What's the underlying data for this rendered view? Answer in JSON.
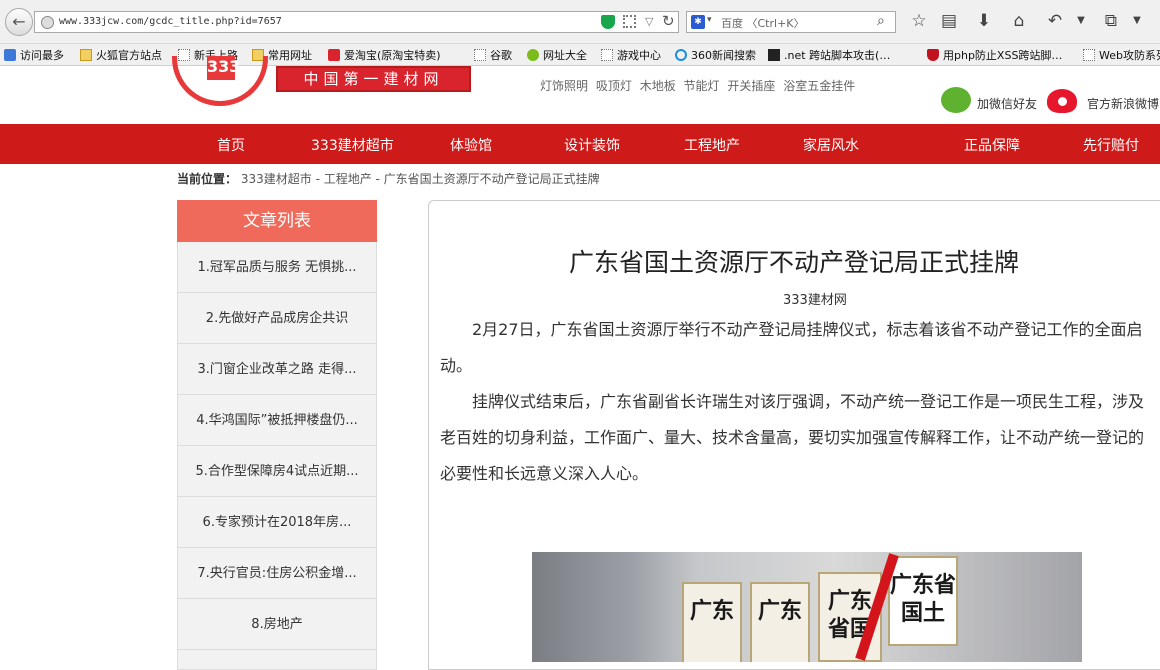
{
  "browser": {
    "url": "www.333jcw.com/gcdc_title.php?id=7657",
    "search_engine": "百度",
    "search_placeholder": "百度 〈Ctrl+K〉"
  },
  "bookmarks": [
    "访问最多",
    "火狐官方站点",
    "新手上路",
    "常用网址",
    "爱淘宝(原淘宝特卖)",
    "谷歌",
    "网址大全",
    "游戏中心",
    "360新闻搜索",
    ".net 跨站脚本攻击(…",
    "用php防止XSS跨站脚…",
    "Web攻防系列"
  ],
  "header": {
    "logo_text": "中国第一建材网",
    "seal_text": "333",
    "keywords": [
      "灯饰照明",
      "吸顶灯",
      "木地板",
      "节能灯",
      "开关插座",
      "浴室五金挂件"
    ],
    "wechat_label": "加微信好友",
    "weibo_label": "官方新浪微博"
  },
  "nav": [
    "首页",
    "333建材超市",
    "体验馆",
    "设计装饰",
    "工程地产",
    "家居风水",
    "正品保障",
    "先行赔付"
  ],
  "breadcrumb": {
    "label": "当前位置：",
    "path": "333建材超市 - 工程地产 - 广东省国土资源厅不动产登记局正式挂牌"
  },
  "sidebar": {
    "title": "文章列表",
    "items": [
      "1.冠军品质与服务 无惧挑...",
      "2.先做好产品成房企共识",
      "3.门窗企业改革之路 走得...",
      "4.华鸿国际”被抵押楼盘仍...",
      "5.合作型保障房4试点近期...",
      "6.专家预计在2018年房...",
      "7.央行官员:住房公积金增...",
      "8.房地产"
    ]
  },
  "article": {
    "title": "广东省国土资源厅不动产登记局正式挂牌",
    "source": "333建材网",
    "paragraphs": [
      "2月27日，广东省国土资源厅举行不动产登记局挂牌仪式，标志着该省不动产登记工作的全面启动。",
      "挂牌仪式结束后，广东省副省长许瑞生对该厅强调，不动产统一登记工作是一项民生工程，涉及老百姓的切身利益，工作面广、量大、技术含量高，要切实加强宣传解释工作，让不动产统一登记的必要性和长远意义深入人心。"
    ],
    "image_signs": [
      "广东",
      "广东",
      "广东省国",
      "广东省国土"
    ]
  }
}
